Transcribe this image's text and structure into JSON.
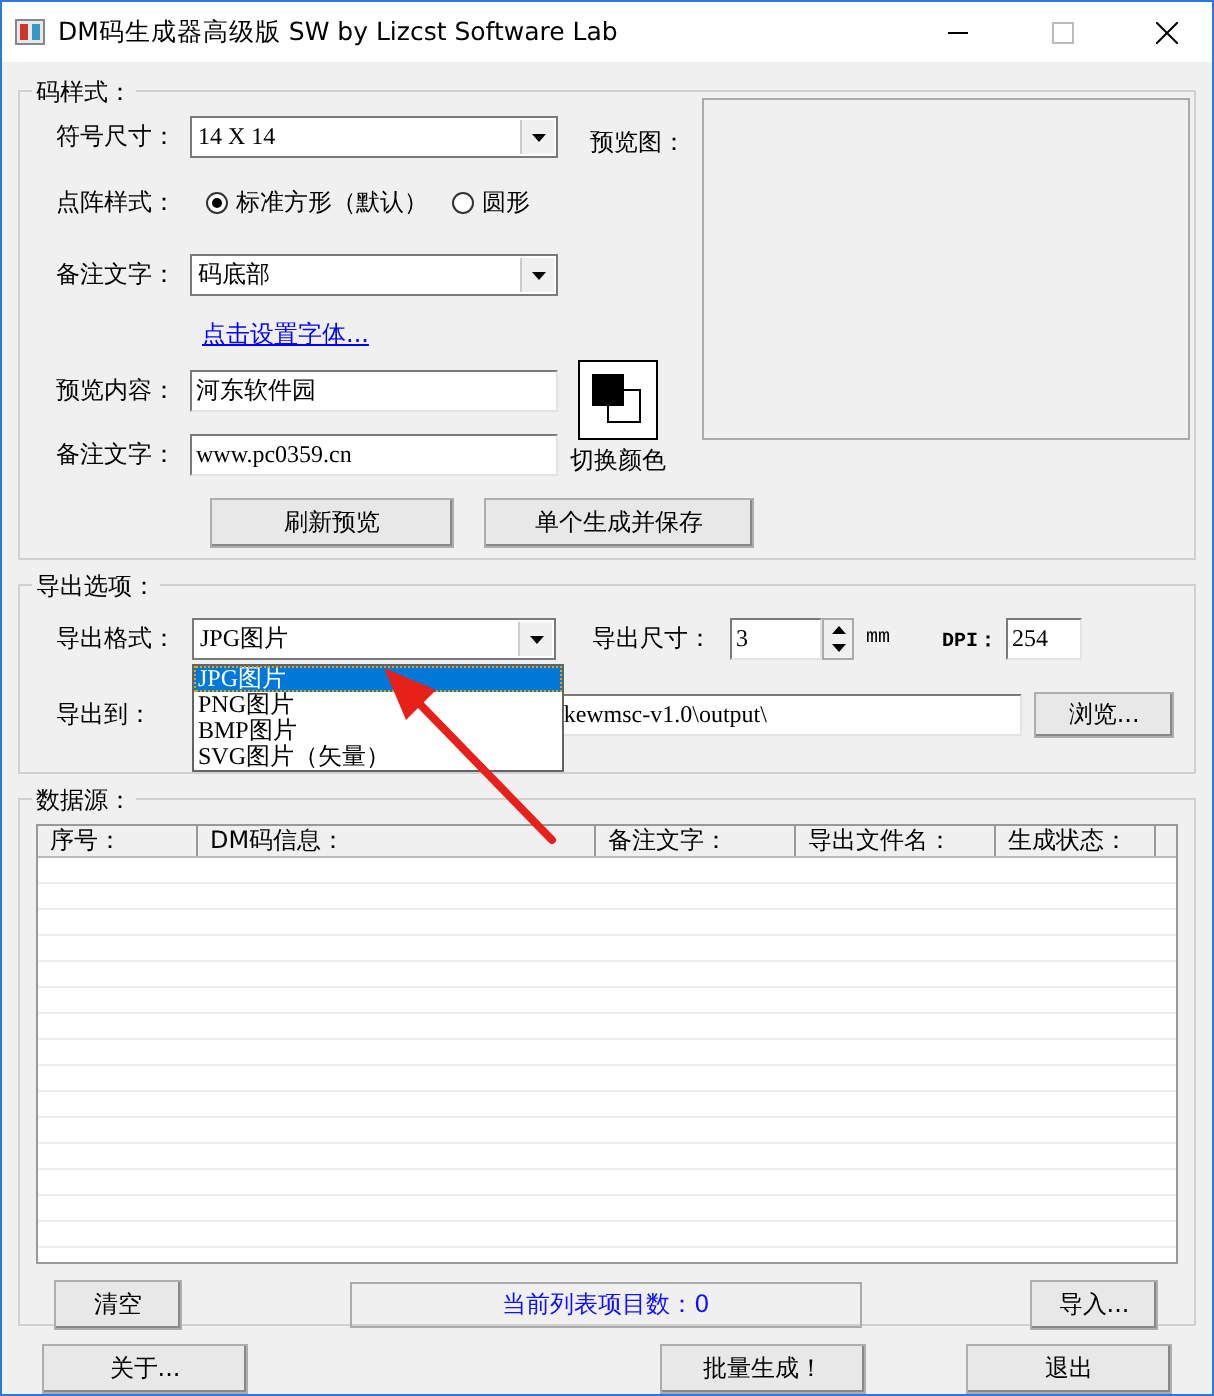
{
  "window": {
    "title": "DM码生成器高级版 SW  by Lizcst Software Lab"
  },
  "code_style": {
    "title": "码样式：",
    "symbol_size": {
      "label": "符号尺寸：",
      "value": "14 X 14"
    },
    "dot_style": {
      "label": "点阵样式：",
      "options": [
        {
          "label": "标准方形（默认）",
          "selected": true
        },
        {
          "label": "圆形",
          "selected": false
        }
      ]
    },
    "note_position": {
      "label": "备注文字：",
      "value": "码底部"
    },
    "font_link": "点击设置字体...",
    "preview_content": {
      "label": "预览内容：",
      "value": "河东软件园"
    },
    "note_text": {
      "label": "备注文字：",
      "value": "www.pc0359.cn"
    },
    "swap_colors": "切换颜色",
    "preview_label": "预览图：",
    "buttons": [
      "刷新预览",
      "单个生成并保存"
    ]
  },
  "export": {
    "title": "导出选项：",
    "format": {
      "label": "导出格式：",
      "value": "JPG图片",
      "expanded": true,
      "options": [
        {
          "label": "JPG图片",
          "selected": true
        },
        {
          "label": "PNG图片",
          "selected": false
        },
        {
          "label": "BMP图片",
          "selected": false
        },
        {
          "label": "SVG图片（矢量）",
          "selected": false
        }
      ]
    },
    "size": {
      "label": "导出尺寸：",
      "value": "3",
      "unit": "mm"
    },
    "dpi": {
      "label": "DPI：",
      "value": "254"
    },
    "output": {
      "label": "导出到：",
      "value": "kewmsc-v1.0\\output\\"
    },
    "browse": "浏览..."
  },
  "data_source": {
    "title": "数据源：",
    "columns": [
      "序号：",
      "DM码信息：",
      "备注文字：",
      "导出文件名：",
      "生成状态："
    ],
    "clear": "清空",
    "status": "当前列表项目数：0",
    "import": "导入..."
  },
  "buttons": [
    "关于...",
    "批量生成！",
    "退出"
  ]
}
